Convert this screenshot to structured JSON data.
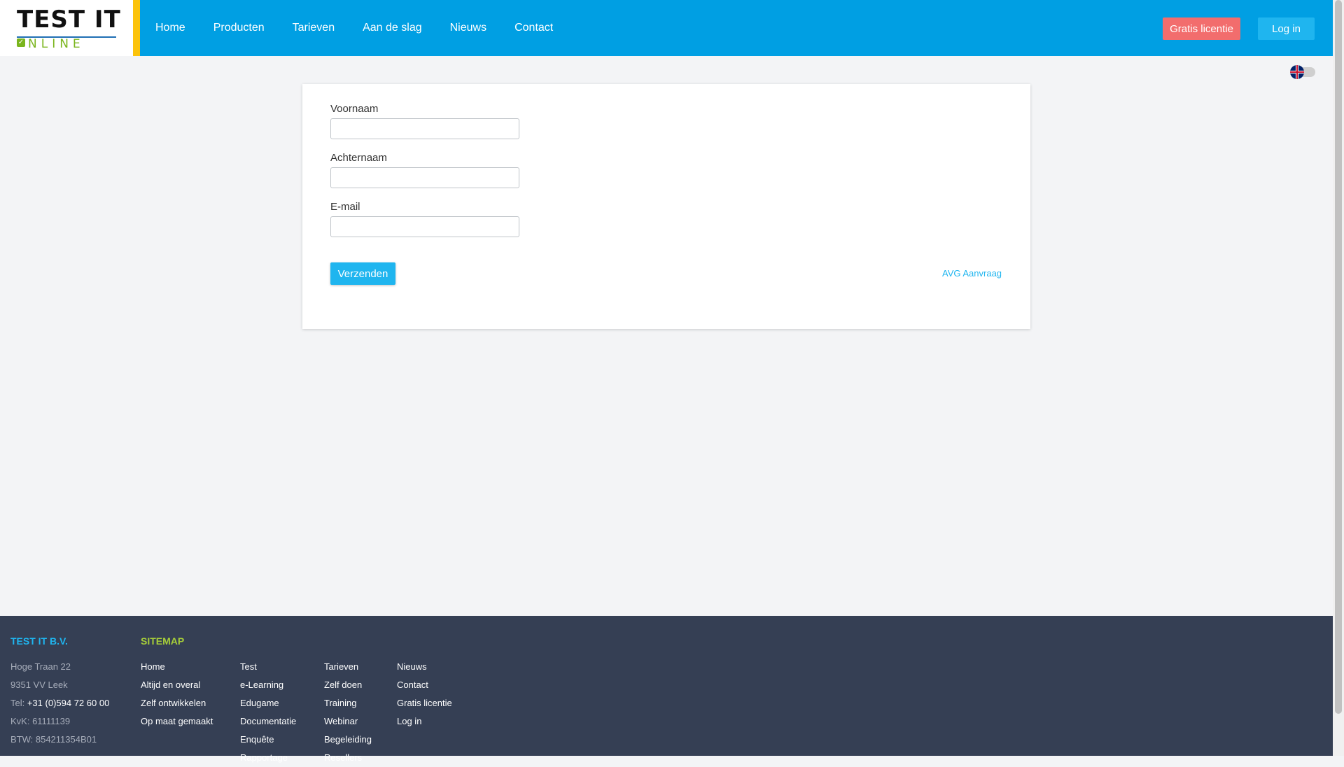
{
  "header": {
    "logo": {
      "top": "TEST IT",
      "bottom": "NLINE"
    },
    "nav": [
      "Home",
      "Producten",
      "Tarieven",
      "Aan de slag",
      "Nieuws",
      "Contact"
    ],
    "gratis_label": "Gratis licentie",
    "login_label": "Log in"
  },
  "form": {
    "fields": [
      {
        "label": "Voornaam",
        "value": ""
      },
      {
        "label": "Achternaam",
        "value": ""
      },
      {
        "label": "E-mail",
        "value": ""
      }
    ],
    "submit_label": "Verzenden",
    "avg_link": "AVG Aanvraag"
  },
  "footer": {
    "company_title": "TEST IT B.V.",
    "address": [
      "Hoge Traan 22",
      "9351 VV Leek"
    ],
    "tel_prefix": "Tel: ",
    "tel": "+31 (0)594 72 60 00",
    "kvk": "KvK: 61111139",
    "btw": "BTW: 854211354B01",
    "sitemap_title": "SITEMAP",
    "col1": [
      "Home",
      "Altijd en overal",
      "Zelf ontwikkelen",
      "Op maat gemaakt"
    ],
    "col2": [
      "Test",
      "e-Learning",
      "Edugame",
      "Documentatie",
      "Enquête",
      "Rapportage"
    ],
    "col3": [
      "Tarieven",
      "Zelf doen",
      "Training",
      "Webinar",
      "Begeleiding",
      "Resellers"
    ],
    "col4": [
      "Nieuws",
      "Contact",
      "Gratis licentie",
      "Log in"
    ]
  },
  "colors": {
    "header_blue": "#009fe3",
    "accent_yellow": "#fcc30b",
    "button_red": "#f26d6d",
    "button_blue": "#1fb5ef",
    "footer_bg": "#353f54",
    "footer_title_blue": "#1fb5ef",
    "footer_title_green": "#a6ce39"
  }
}
